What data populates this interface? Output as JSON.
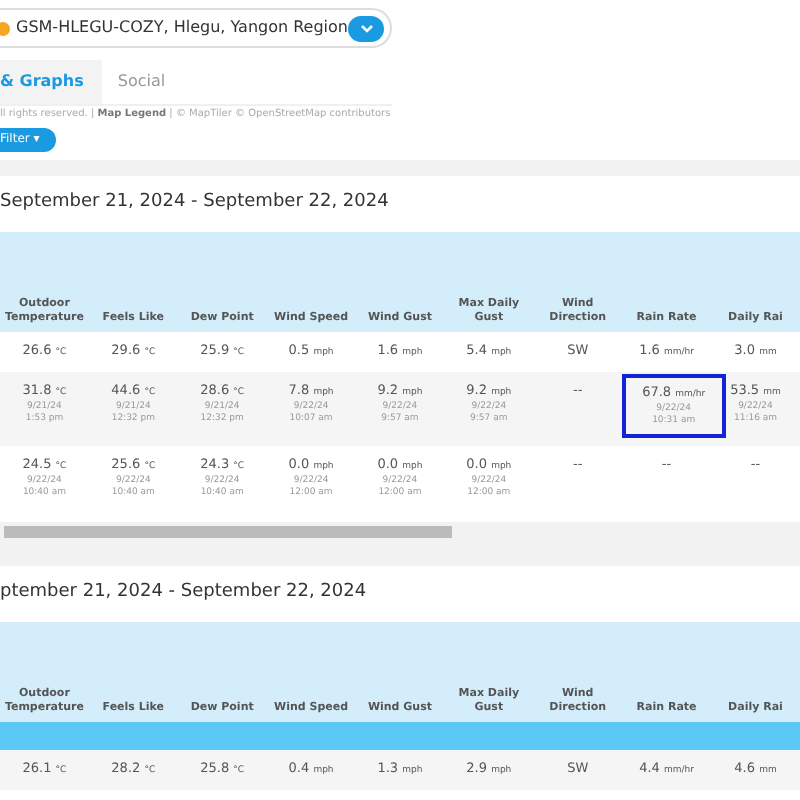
{
  "station": {
    "label": "GSM-HLEGU-COZY, Hlegu, Yangon Region"
  },
  "tabs": [
    {
      "label": "& Graphs",
      "selected": true
    },
    {
      "label": "Social",
      "selected": false
    }
  ],
  "map_attribution": {
    "prefix": "ll rights reserved. |",
    "legend_link": "Map Legend",
    "suffix": "| © MapTiler © OpenStreetMap contributors"
  },
  "filter_button": "Filter ▾",
  "sections": [
    {
      "title": "September 21, 2024 - September 22, 2024",
      "columns": [
        "Outdoor Temperature",
        "Feels Like",
        "Dew Point",
        "Wind Speed",
        "Wind Gust",
        "Max Daily Gust",
        "Wind Direction",
        "Rain Rate",
        "Daily Rai"
      ],
      "blue_bar": false,
      "scrollbar": true,
      "rows": [
        [
          {
            "value": "26.6",
            "unit": "°C",
            "selected": false
          },
          {
            "value": "29.6",
            "unit": "°C",
            "selected": false
          },
          {
            "value": "25.9",
            "unit": "°C",
            "selected": false
          },
          {
            "value": "0.5",
            "unit": "mph",
            "selected": false
          },
          {
            "value": "1.6",
            "unit": "mph",
            "selected": false
          },
          {
            "value": "5.4",
            "unit": "mph",
            "selected": false
          },
          {
            "value": "SW",
            "selected": false
          },
          {
            "value": "1.6",
            "unit": "mm/hr",
            "selected": false
          },
          {
            "value": "3.0",
            "unit": "mm",
            "selected": false
          }
        ],
        [
          {
            "value": "31.8",
            "unit": "°C",
            "date": "9/21/24",
            "time": "1:53 pm",
            "selected": false
          },
          {
            "value": "44.6",
            "unit": "°C",
            "date": "9/21/24",
            "time": "12:32 pm",
            "selected": false
          },
          {
            "value": "28.6",
            "unit": "°C",
            "date": "9/21/24",
            "time": "12:32 pm",
            "selected": false
          },
          {
            "value": "7.8",
            "unit": "mph",
            "date": "9/22/24",
            "time": "10:07 am",
            "selected": false
          },
          {
            "value": "9.2",
            "unit": "mph",
            "date": "9/22/24",
            "time": "9:57 am",
            "selected": false
          },
          {
            "value": "9.2",
            "unit": "mph",
            "date": "9/22/24",
            "time": "9:57 am",
            "selected": false
          },
          {
            "value": "--",
            "selected": false
          },
          {
            "value": "67.8",
            "unit": "mm/hr",
            "date": "9/22/24",
            "time": "10:31 am",
            "selected": true
          },
          {
            "value": "53.5",
            "unit": "mm",
            "date": "9/22/24",
            "time": "11:16 am",
            "selected": false
          }
        ],
        [
          {
            "value": "24.5",
            "unit": "°C",
            "date": "9/22/24",
            "time": "10:40 am",
            "selected": false
          },
          {
            "value": "25.6",
            "unit": "°C",
            "date": "9/22/24",
            "time": "10:40 am",
            "selected": false
          },
          {
            "value": "24.3",
            "unit": "°C",
            "date": "9/22/24",
            "time": "10:40 am",
            "selected": false
          },
          {
            "value": "0.0",
            "unit": "mph",
            "date": "9/22/24",
            "time": "12:00 am",
            "selected": false
          },
          {
            "value": "0.0",
            "unit": "mph",
            "date": "9/22/24",
            "time": "12:00 am",
            "selected": false
          },
          {
            "value": "0.0",
            "unit": "mph",
            "date": "9/22/24",
            "time": "12:00 am",
            "selected": false
          },
          {
            "value": "--",
            "selected": false
          },
          {
            "value": "--",
            "selected": false
          },
          {
            "value": "--",
            "selected": false
          }
        ]
      ]
    },
    {
      "title": "ptember 21, 2024 - September 22, 2024",
      "columns": [
        "Outdoor Temperature",
        "Feels Like",
        "Dew Point",
        "Wind Speed",
        "Wind Gust",
        "Max Daily Gust",
        "Wind Direction",
        "Rain Rate",
        "Daily Rai"
      ],
      "blue_bar": true,
      "scrollbar": false,
      "rows": [
        [
          {
            "value": "26.1",
            "unit": "°C",
            "selected": false
          },
          {
            "value": "28.2",
            "unit": "°C",
            "selected": false
          },
          {
            "value": "25.8",
            "unit": "°C",
            "selected": false
          },
          {
            "value": "0.4",
            "unit": "mph",
            "selected": false
          },
          {
            "value": "1.3",
            "unit": "mph",
            "selected": false
          },
          {
            "value": "2.9",
            "unit": "mph",
            "selected": false
          },
          {
            "value": "SW",
            "selected": false
          },
          {
            "value": "4.4",
            "unit": "mm/hr",
            "selected": false
          },
          {
            "value": "4.6",
            "unit": "mm",
            "selected": false
          }
        ]
      ]
    }
  ]
}
